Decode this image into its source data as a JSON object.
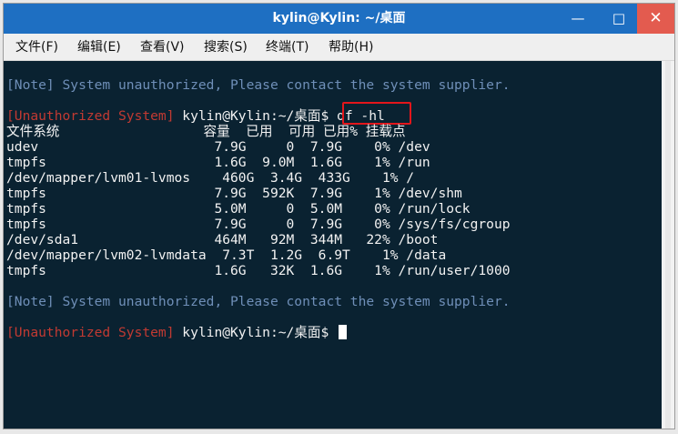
{
  "window": {
    "title": "kylin@Kylin: ~/桌面",
    "controls": {
      "minimize": "—",
      "maximize": "□",
      "close": "✕"
    }
  },
  "menu": [
    "文件(F)",
    "编辑(E)",
    "查看(V)",
    "搜索(S)",
    "终端(T)",
    "帮助(H)"
  ],
  "terminal": {
    "note1": "[Note] System unauthorized, Please contact the system supplier.",
    "prompt1": {
      "warning": "[Unauthorized System]",
      "user": " kylin@Kylin:~/桌面$ ",
      "command": "df -hl"
    },
    "header": "文件系统                  容量  已用  可用 已用% 挂载点",
    "rows": [
      "udev                      7.9G     0  7.9G    0% /dev",
      "tmpfs                     1.6G  9.0M  1.6G    1% /run",
      "/dev/mapper/lvm01-lvmos    460G  3.4G  433G    1% /",
      "tmpfs                     7.9G  592K  7.9G    1% /dev/shm",
      "tmpfs                     5.0M     0  5.0M    0% /run/lock",
      "tmpfs                     7.9G     0  7.9G    0% /sys/fs/cgroup",
      "/dev/sda1                 464M   92M  344M   22% /boot",
      "/dev/mapper/lvm02-lvmdata  7.3T  1.2G  6.9T    1% /data",
      "tmpfs                     1.6G   32K  1.6G    1% /run/user/1000"
    ],
    "note2": "[Note] System unauthorized, Please contact the system supplier.",
    "prompt2": {
      "warning": "[Unauthorized System]",
      "user": " kylin@Kylin:~/桌面$ "
    }
  },
  "colors": {
    "titlebar": "#1e6fc2",
    "terminal_bg": "#0a2231",
    "note": "#6f8fb8",
    "warning": "#c23a32",
    "highlight": "#e3161b"
  }
}
